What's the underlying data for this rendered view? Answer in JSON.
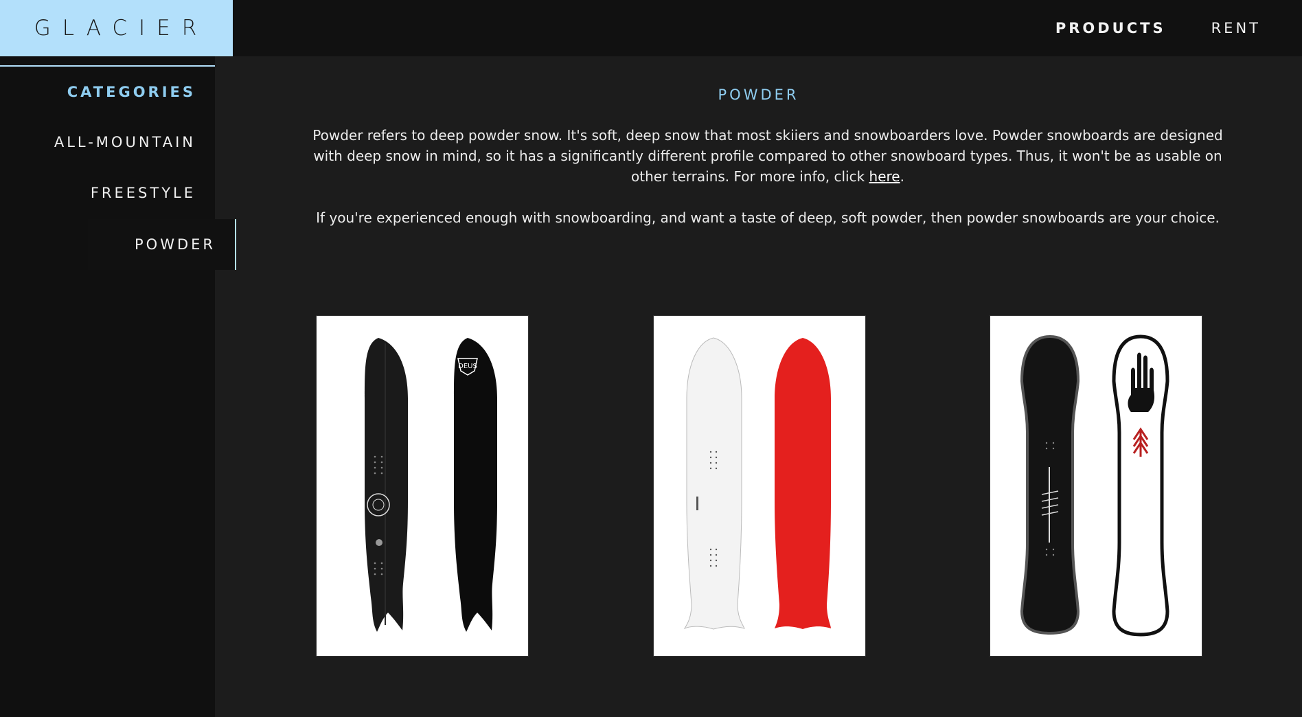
{
  "header": {
    "logo": "GLACIER",
    "nav": [
      {
        "label": "PRODUCTS",
        "active": true
      },
      {
        "label": "RENT",
        "active": false
      }
    ]
  },
  "sidebar": {
    "heading": "CATEGORIES",
    "items": [
      {
        "label": "ALL-MOUNTAIN"
      },
      {
        "label": "FREESTYLE"
      },
      {
        "label": "POWDER",
        "active": true
      }
    ]
  },
  "main": {
    "title": "POWDER",
    "description_before_link": "Powder refers to deep powder snow. It's soft, deep snow that most skiiers and snowboarders love. Powder snowboards are designed with deep snow in mind, so it has a significantly different profile compared to other snowboard types. Thus, it won't be as usable on other terrains. For more info, click ",
    "description_link": "here",
    "description_after_link": ".",
    "description_2": "If you're experienced enough with snowboarding, and want a taste of deep, soft powder, then powder snowboards are your choice.",
    "products": [
      {
        "name": "snowboard-black-fishtail",
        "colors": [
          "#1a1a1a",
          "#0c0c0c"
        ],
        "brand_text": "DEUS"
      },
      {
        "name": "snowboard-white-red",
        "colors": [
          "#f3f3f3",
          "#e4201e"
        ]
      },
      {
        "name": "snowboard-black-white-hand",
        "colors": [
          "#141414",
          "#ffffff"
        ]
      }
    ]
  },
  "colors": {
    "accent": "#b3e0fb",
    "accent_text": "#8fcdf0",
    "background": "#1c1c1c",
    "sidebar": "#101010",
    "topbar": "#111111"
  }
}
